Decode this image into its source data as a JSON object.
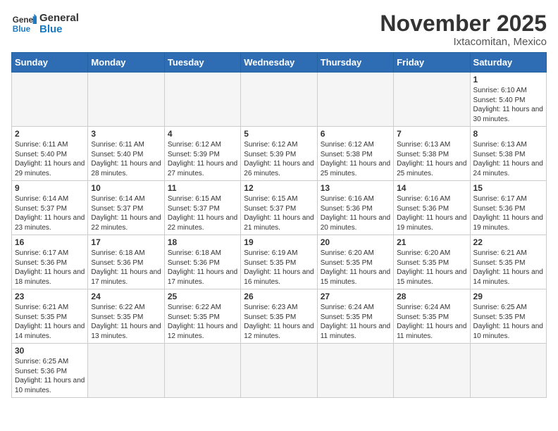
{
  "logo": {
    "general": "General",
    "blue": "Blue"
  },
  "header": {
    "title": "November 2025",
    "subtitle": "Ixtacomitan, Mexico"
  },
  "weekdays": [
    "Sunday",
    "Monday",
    "Tuesday",
    "Wednesday",
    "Thursday",
    "Friday",
    "Saturday"
  ],
  "weeks": [
    [
      {
        "day": "",
        "info": ""
      },
      {
        "day": "",
        "info": ""
      },
      {
        "day": "",
        "info": ""
      },
      {
        "day": "",
        "info": ""
      },
      {
        "day": "",
        "info": ""
      },
      {
        "day": "",
        "info": ""
      },
      {
        "day": "1",
        "info": "Sunrise: 6:10 AM\nSunset: 5:40 PM\nDaylight: 11 hours and 30 minutes."
      }
    ],
    [
      {
        "day": "2",
        "info": "Sunrise: 6:11 AM\nSunset: 5:40 PM\nDaylight: 11 hours and 29 minutes."
      },
      {
        "day": "3",
        "info": "Sunrise: 6:11 AM\nSunset: 5:40 PM\nDaylight: 11 hours and 28 minutes."
      },
      {
        "day": "4",
        "info": "Sunrise: 6:12 AM\nSunset: 5:39 PM\nDaylight: 11 hours and 27 minutes."
      },
      {
        "day": "5",
        "info": "Sunrise: 6:12 AM\nSunset: 5:39 PM\nDaylight: 11 hours and 26 minutes."
      },
      {
        "day": "6",
        "info": "Sunrise: 6:12 AM\nSunset: 5:38 PM\nDaylight: 11 hours and 25 minutes."
      },
      {
        "day": "7",
        "info": "Sunrise: 6:13 AM\nSunset: 5:38 PM\nDaylight: 11 hours and 25 minutes."
      },
      {
        "day": "8",
        "info": "Sunrise: 6:13 AM\nSunset: 5:38 PM\nDaylight: 11 hours and 24 minutes."
      }
    ],
    [
      {
        "day": "9",
        "info": "Sunrise: 6:14 AM\nSunset: 5:37 PM\nDaylight: 11 hours and 23 minutes."
      },
      {
        "day": "10",
        "info": "Sunrise: 6:14 AM\nSunset: 5:37 PM\nDaylight: 11 hours and 22 minutes."
      },
      {
        "day": "11",
        "info": "Sunrise: 6:15 AM\nSunset: 5:37 PM\nDaylight: 11 hours and 22 minutes."
      },
      {
        "day": "12",
        "info": "Sunrise: 6:15 AM\nSunset: 5:37 PM\nDaylight: 11 hours and 21 minutes."
      },
      {
        "day": "13",
        "info": "Sunrise: 6:16 AM\nSunset: 5:36 PM\nDaylight: 11 hours and 20 minutes."
      },
      {
        "day": "14",
        "info": "Sunrise: 6:16 AM\nSunset: 5:36 PM\nDaylight: 11 hours and 19 minutes."
      },
      {
        "day": "15",
        "info": "Sunrise: 6:17 AM\nSunset: 5:36 PM\nDaylight: 11 hours and 19 minutes."
      }
    ],
    [
      {
        "day": "16",
        "info": "Sunrise: 6:17 AM\nSunset: 5:36 PM\nDaylight: 11 hours and 18 minutes."
      },
      {
        "day": "17",
        "info": "Sunrise: 6:18 AM\nSunset: 5:36 PM\nDaylight: 11 hours and 17 minutes."
      },
      {
        "day": "18",
        "info": "Sunrise: 6:18 AM\nSunset: 5:36 PM\nDaylight: 11 hours and 17 minutes."
      },
      {
        "day": "19",
        "info": "Sunrise: 6:19 AM\nSunset: 5:35 PM\nDaylight: 11 hours and 16 minutes."
      },
      {
        "day": "20",
        "info": "Sunrise: 6:20 AM\nSunset: 5:35 PM\nDaylight: 11 hours and 15 minutes."
      },
      {
        "day": "21",
        "info": "Sunrise: 6:20 AM\nSunset: 5:35 PM\nDaylight: 11 hours and 15 minutes."
      },
      {
        "day": "22",
        "info": "Sunrise: 6:21 AM\nSunset: 5:35 PM\nDaylight: 11 hours and 14 minutes."
      }
    ],
    [
      {
        "day": "23",
        "info": "Sunrise: 6:21 AM\nSunset: 5:35 PM\nDaylight: 11 hours and 14 minutes."
      },
      {
        "day": "24",
        "info": "Sunrise: 6:22 AM\nSunset: 5:35 PM\nDaylight: 11 hours and 13 minutes."
      },
      {
        "day": "25",
        "info": "Sunrise: 6:22 AM\nSunset: 5:35 PM\nDaylight: 11 hours and 12 minutes."
      },
      {
        "day": "26",
        "info": "Sunrise: 6:23 AM\nSunset: 5:35 PM\nDaylight: 11 hours and 12 minutes."
      },
      {
        "day": "27",
        "info": "Sunrise: 6:24 AM\nSunset: 5:35 PM\nDaylight: 11 hours and 11 minutes."
      },
      {
        "day": "28",
        "info": "Sunrise: 6:24 AM\nSunset: 5:35 PM\nDaylight: 11 hours and 11 minutes."
      },
      {
        "day": "29",
        "info": "Sunrise: 6:25 AM\nSunset: 5:35 PM\nDaylight: 11 hours and 10 minutes."
      }
    ],
    [
      {
        "day": "30",
        "info": "Sunrise: 6:25 AM\nSunset: 5:36 PM\nDaylight: 11 hours and 10 minutes."
      },
      {
        "day": "",
        "info": ""
      },
      {
        "day": "",
        "info": ""
      },
      {
        "day": "",
        "info": ""
      },
      {
        "day": "",
        "info": ""
      },
      {
        "day": "",
        "info": ""
      },
      {
        "day": "",
        "info": ""
      }
    ]
  ]
}
